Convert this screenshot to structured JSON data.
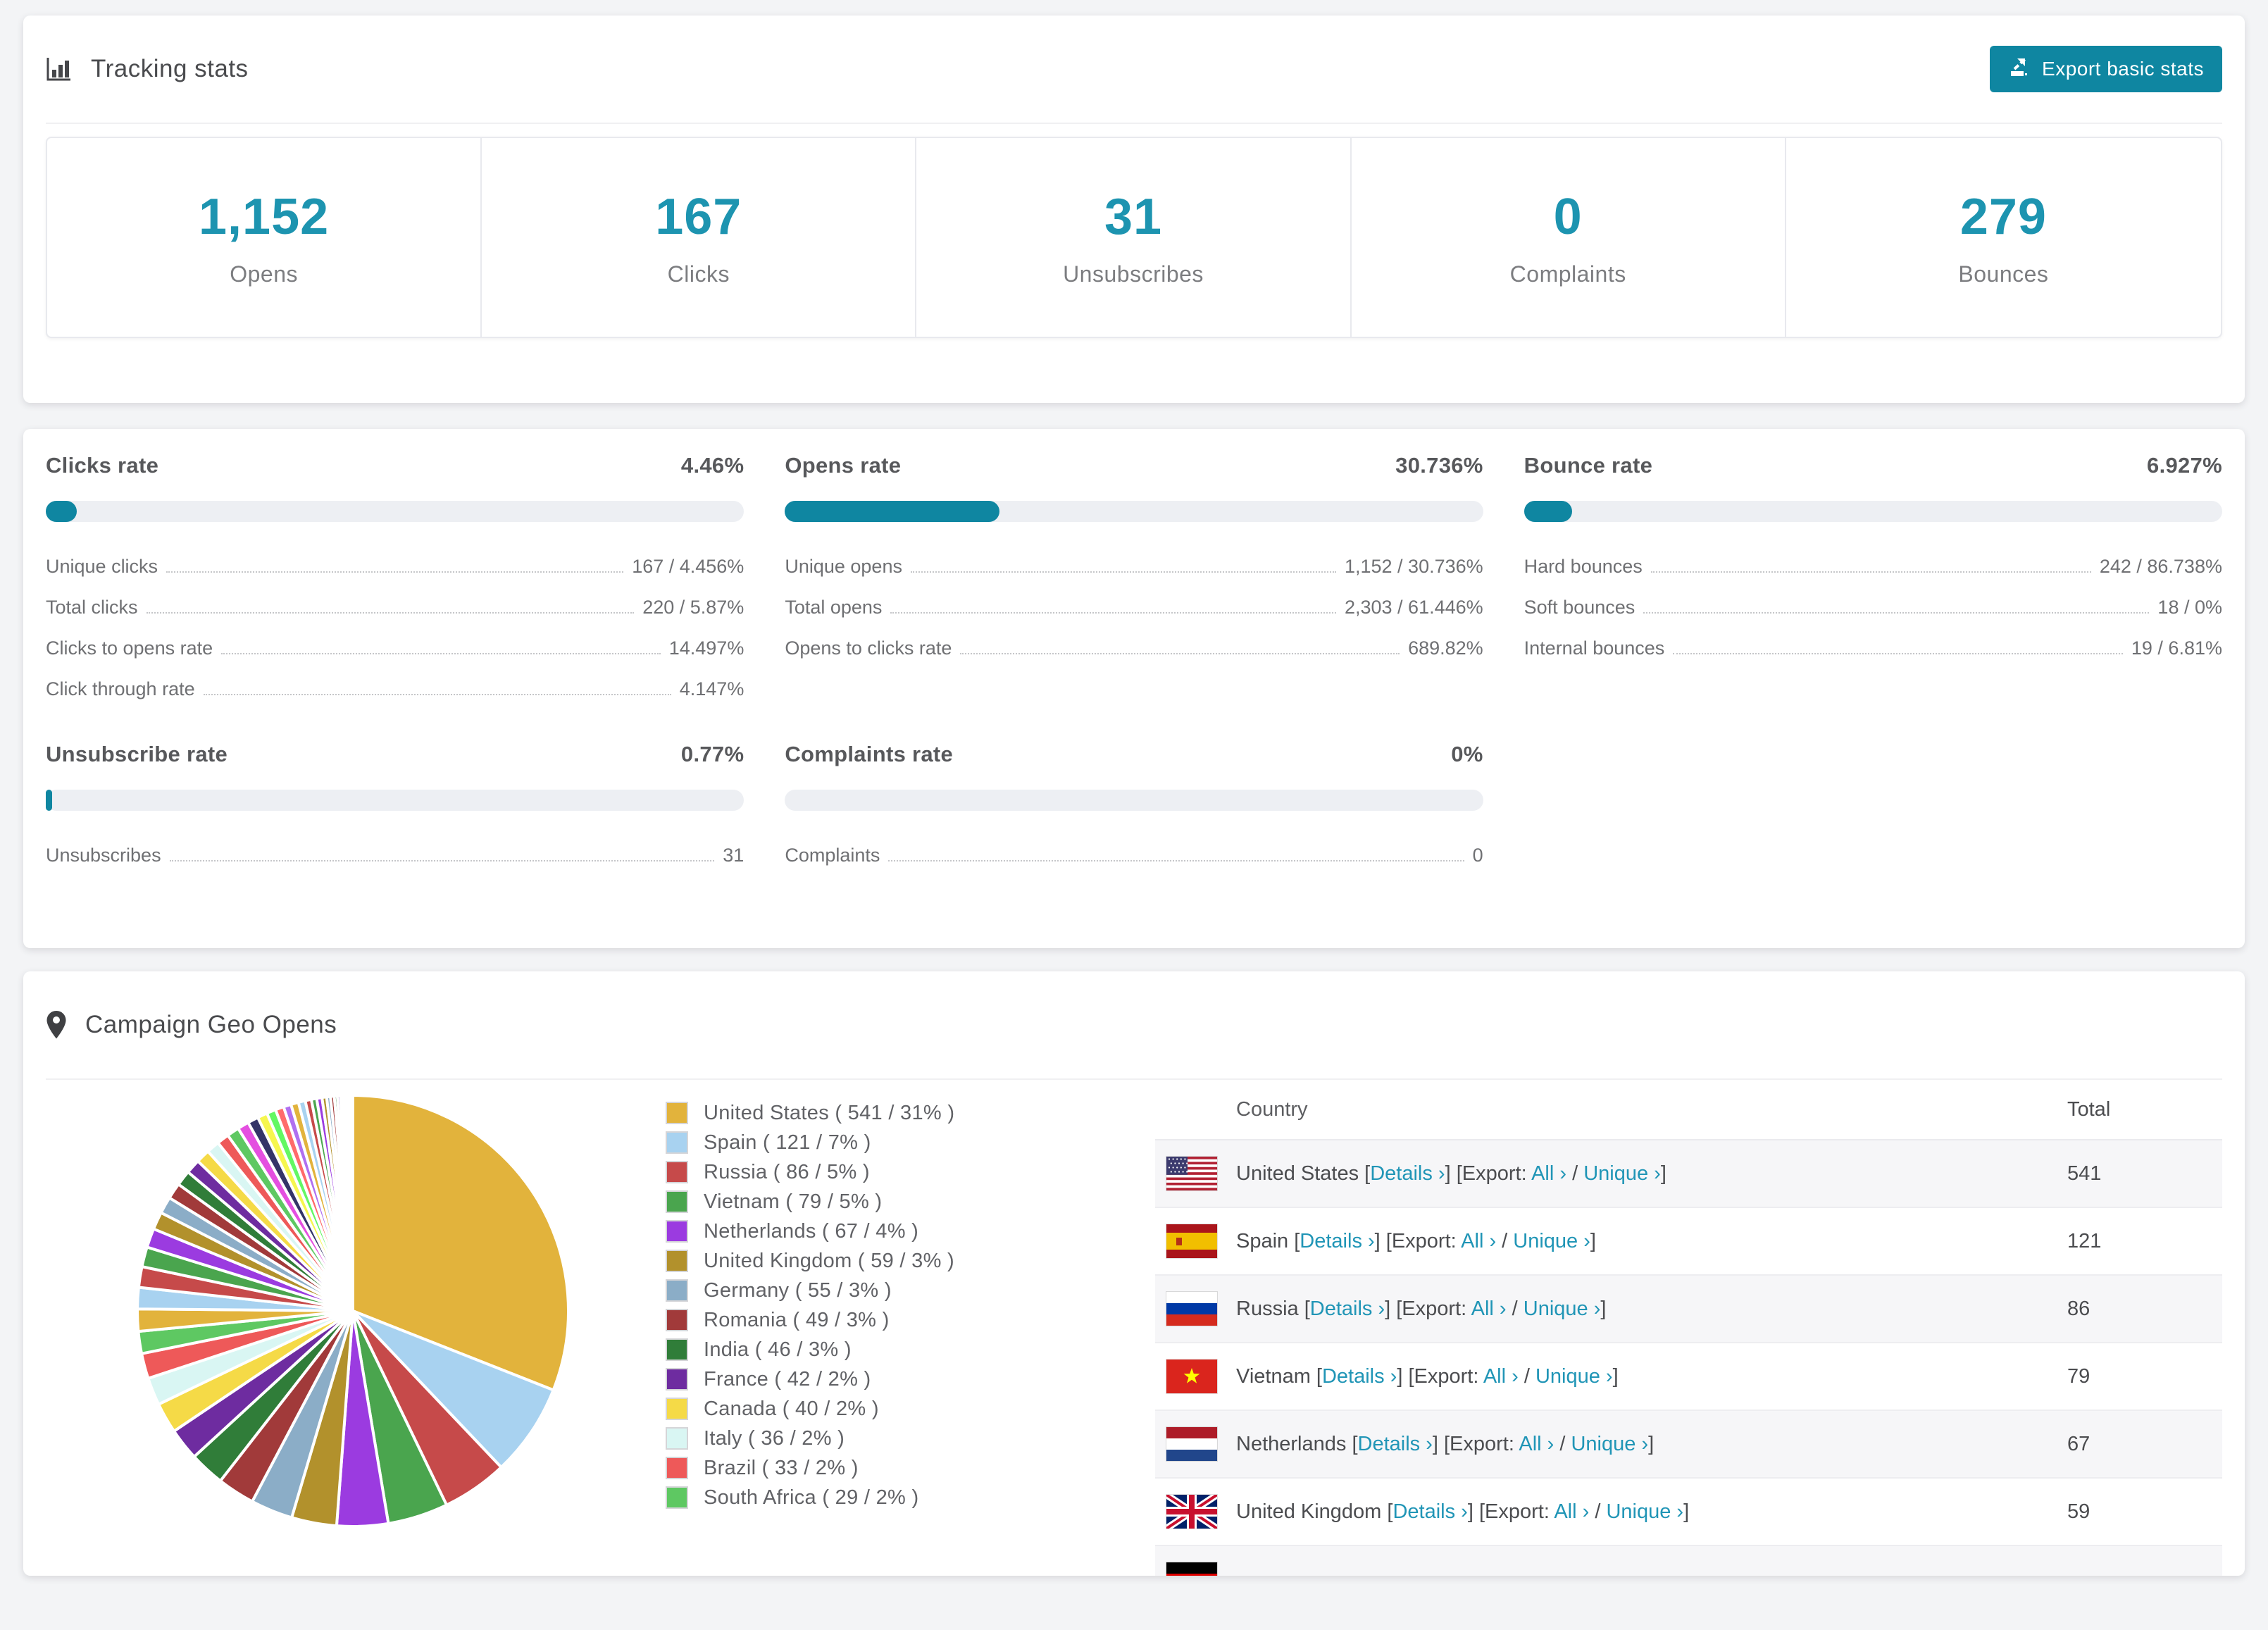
{
  "colors": {
    "page_bg": "#f3f4f6",
    "accent_teal": "#0f86a1",
    "stat_number_teal": "#1d94b0",
    "link_teal": "#2095b6",
    "progress_track": "#edeff3",
    "striped_row": "#f6f6f8"
  },
  "icons": {
    "title_icon": "bar-chart",
    "export_icon": "export-arrow-up-right",
    "geo_icon": "map-pin"
  },
  "tracking_card": {
    "title": "Tracking stats",
    "export_label": "Export basic stats",
    "stats": [
      {
        "value": "1,152",
        "label": "Opens"
      },
      {
        "value": "167",
        "label": "Clicks"
      },
      {
        "value": "31",
        "label": "Unsubscribes"
      },
      {
        "value": "0",
        "label": "Complaints"
      },
      {
        "value": "279",
        "label": "Bounces"
      }
    ]
  },
  "rates_card": {
    "blocks": [
      {
        "title": "Clicks rate",
        "value": "4.46%",
        "pct": 4.46,
        "rows": [
          [
            "Unique clicks",
            "167 / 4.456%"
          ],
          [
            "Total clicks",
            "220 / 5.87%"
          ],
          [
            "Clicks to opens rate",
            "14.497%"
          ],
          [
            "Click through rate",
            "4.147%"
          ]
        ]
      },
      {
        "title": "Opens rate",
        "value": "30.736%",
        "pct": 30.736,
        "rows": [
          [
            "Unique opens",
            "1,152 / 30.736%"
          ],
          [
            "Total opens",
            "2,303 / 61.446%"
          ],
          [
            "Opens to clicks rate",
            "689.82%"
          ]
        ]
      },
      {
        "title": "Bounce rate",
        "value": "6.927%",
        "pct": 6.927,
        "rows": [
          [
            "Hard bounces",
            "242 / 86.738%"
          ],
          [
            "Soft bounces",
            "18 / 0%"
          ],
          [
            "Internal bounces",
            "19 / 6.81%"
          ]
        ]
      },
      {
        "title": "Unsubscribe rate",
        "value": "0.77%",
        "pct": 0.77,
        "rows": [
          [
            "Unsubscribes",
            "31"
          ]
        ]
      },
      {
        "title": "Complaints rate",
        "value": "0%",
        "pct": 0,
        "rows": [
          [
            "Complaints",
            "0"
          ]
        ]
      }
    ]
  },
  "geo_card": {
    "title": "Campaign Geo Opens",
    "chart_data": {
      "type": "pie",
      "title": "Campaign Geo Opens",
      "legend_position": "right",
      "start_angle": "12-o-clock, clockwise",
      "series": [
        {
          "name": "United States",
          "value": 541,
          "pct": 31,
          "color": "#e2b33c"
        },
        {
          "name": "Spain",
          "value": 121,
          "pct": 7,
          "color": "#a8d2f0"
        },
        {
          "name": "Russia",
          "value": 86,
          "pct": 5,
          "color": "#c64a4a"
        },
        {
          "name": "Vietnam",
          "value": 79,
          "pct": 5,
          "color": "#4aa54e"
        },
        {
          "name": "Netherlands",
          "value": 67,
          "pct": 4,
          "color": "#9b3be0"
        },
        {
          "name": "United Kingdom",
          "value": 59,
          "pct": 3,
          "color": "#b2912c"
        },
        {
          "name": "Germany",
          "value": 55,
          "pct": 3,
          "color": "#8badc7"
        },
        {
          "name": "Romania",
          "value": 49,
          "pct": 3,
          "color": "#a13a3a"
        },
        {
          "name": "India",
          "value": 46,
          "pct": 3,
          "color": "#307d39"
        },
        {
          "name": "France",
          "value": 42,
          "pct": 2,
          "color": "#6e2ca0"
        },
        {
          "name": "Canada",
          "value": 40,
          "pct": 2,
          "color": "#f5da47"
        },
        {
          "name": "Italy",
          "value": 36,
          "pct": 2,
          "color": "#d9f6f3"
        },
        {
          "name": "Brazil",
          "value": 33,
          "pct": 2,
          "color": "#ee5959"
        },
        {
          "name": "South Africa",
          "value": 29,
          "pct": 2,
          "color": "#5ec862"
        }
      ],
      "others_unlabeled": {
        "estimated_total": 462,
        "slice_count_estimate": 40
      },
      "tail_palette": [
        "#e2b33c",
        "#a8d2f0",
        "#c64a4a",
        "#4aa54e",
        "#9b3be0",
        "#b2912c",
        "#8badc7",
        "#a13a3a",
        "#307d39",
        "#6e2ca0",
        "#f5da47",
        "#d9f6f3",
        "#ee5959",
        "#5ec862",
        "#e44fe0",
        "#343468",
        "#f6f64e",
        "#63f763",
        "#ff6b6b",
        "#b06ff0"
      ]
    },
    "table": {
      "headers": [
        "Country",
        "Total"
      ],
      "labels": {
        "details": "Details ›",
        "export": "Export:",
        "all": "All ›",
        "unique": "Unique ›",
        "lb": "[",
        "rb": "]",
        "slash": "/"
      },
      "rows": [
        {
          "flag": "us",
          "country": "United States",
          "total": "541"
        },
        {
          "flag": "es",
          "country": "Spain",
          "total": "121"
        },
        {
          "flag": "ru",
          "country": "Russia",
          "total": "86"
        },
        {
          "flag": "vn",
          "country": "Vietnam",
          "total": "79"
        },
        {
          "flag": "nl",
          "country": "Netherlands",
          "total": "67"
        },
        {
          "flag": "gb",
          "country": "United Kingdom",
          "total": "59"
        },
        {
          "flag": "de",
          "country": "",
          "total": ""
        }
      ]
    }
  }
}
